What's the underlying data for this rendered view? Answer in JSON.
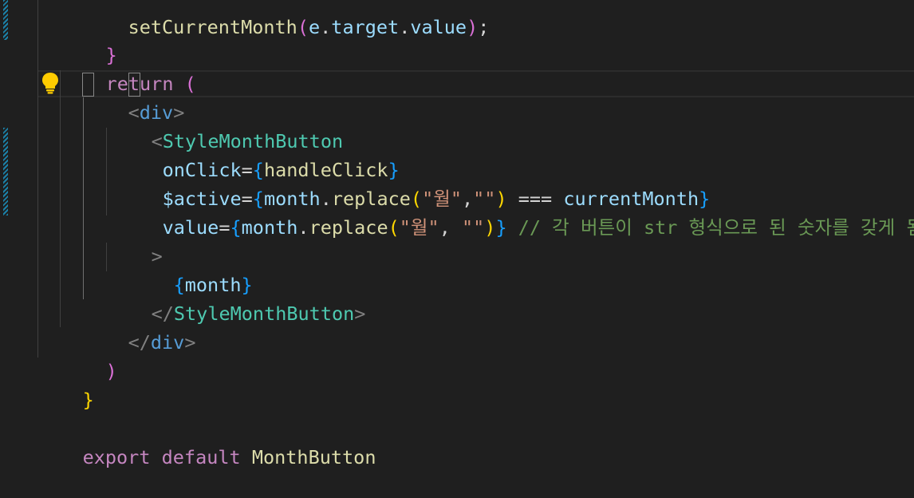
{
  "theme": {
    "background": "#1f1f1f",
    "keyword": "#c586c0",
    "component": "#4ec9b0",
    "html_tag": "#569cd6",
    "attribute": "#9cdcfe",
    "function": "#dcdcaa",
    "string": "#ce9178",
    "comment": "#6a9955",
    "bracket_gold": "#ffd700",
    "bracket_orchid": "#da70d6",
    "bracket_blue": "#179fff",
    "gutter_modified": "#1b81a8"
  },
  "editor": {
    "lightbulb_icon": "lightbulb-icon",
    "lines": {
      "l0": {
        "fn": "setCurrentMonth",
        "p1": "(",
        "v": "e",
        "dot": ".",
        "p": "target",
        "dot2": ".",
        "p2": "value",
        "close": ")",
        "semi": ";"
      },
      "l1": {
        "brace": "}"
      },
      "l2": {
        "kw": "return",
        "sp": " ",
        "paren": "("
      },
      "l3": {
        "open": "<",
        "tag": "div",
        "close": ">"
      },
      "l4": {
        "open": "<",
        "tag": "StyleMonthButton"
      },
      "l5": {
        "attr": "onClick",
        "eq": "=",
        "b1": "{",
        "val": "handleClick",
        "b2": "}"
      },
      "l6": {
        "attr": "$active",
        "eq": "=",
        "b1": "{",
        "obj": "month",
        "dot": ".",
        "fn": "replace",
        "p1": "(",
        "s1": "\"월\"",
        "comma": ",",
        "s2": "\"\"",
        "p2": ")",
        "op": " === ",
        "var": "currentMonth",
        "b2": "}"
      },
      "l7": {
        "attr": "value",
        "eq": "=",
        "b1": "{",
        "obj": "month",
        "dot": ".",
        "fn": "replace",
        "p1": "(",
        "s1": "\"월\"",
        "comma": ", ",
        "s2": "\"\"",
        "p2": ")",
        "b2": "}",
        "comment": " // 각 버튼이 str 형식으로 된 숫자를 갖게 됨"
      },
      "l8": {
        "gt": ">"
      },
      "l9": {
        "b1": "{",
        "var": "month",
        "b2": "}"
      },
      "l10": {
        "open": "</",
        "tag": "StyleMonthButton",
        "close": ">"
      },
      "l11": {
        "open": "</",
        "tag": "div",
        "close": ">"
      },
      "l12": {
        "paren": ")"
      },
      "l13": {
        "brace": "}"
      },
      "l15": {
        "kw1": "export",
        "kw2": "default",
        "name": "MonthButton"
      }
    }
  }
}
